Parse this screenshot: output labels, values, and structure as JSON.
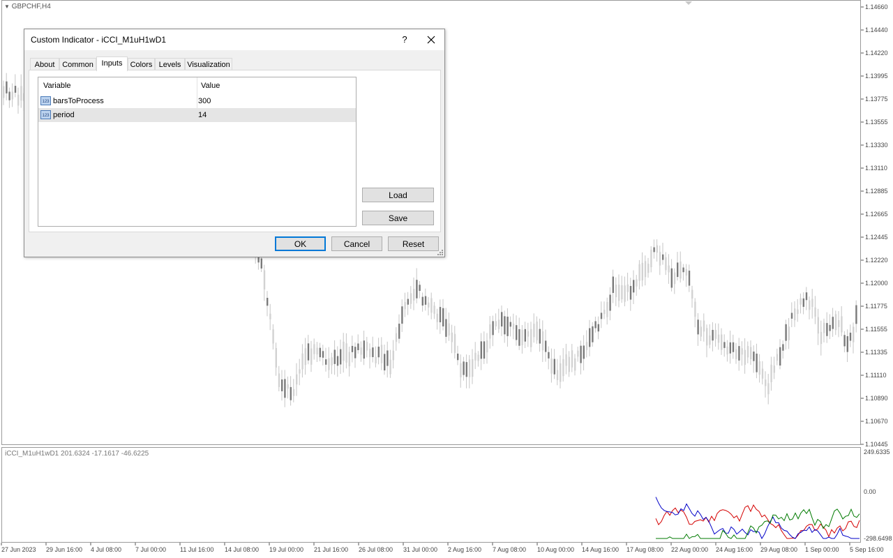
{
  "symbol_label": "GBPCHF,H4",
  "indicator_label": "iCCI_M1uH1wD1 201.6324 -17.1617 -46.6225",
  "price_axis": [
    "1.14660",
    "1.14440",
    "1.14220",
    "1.13995",
    "1.13775",
    "1.13555",
    "1.13330",
    "1.13110",
    "1.12885",
    "1.12665",
    "1.12445",
    "1.12220",
    "1.12000",
    "1.11775",
    "1.11555",
    "1.11335",
    "1.11110",
    "1.10890",
    "1.10670",
    "1.10445"
  ],
  "indicator_axis": [
    "249.6335",
    "0.00",
    "-298.6498"
  ],
  "time_axis": [
    "27 Jun 2023",
    "29 Jun 16:00",
    "4 Jul 08:00",
    "7 Jul 00:00",
    "11 Jul 16:00",
    "14 Jul 08:00",
    "19 Jul 00:00",
    "21 Jul 16:00",
    "26 Jul 08:00",
    "31 Jul 00:00",
    "2 Aug 16:00",
    "7 Aug 08:00",
    "10 Aug 00:00",
    "14 Aug 16:00",
    "17 Aug 08:00",
    "22 Aug 00:00",
    "24 Aug 16:00",
    "29 Aug 08:00",
    "1 Sep 00:00",
    "5 Sep 16:00"
  ],
  "colors": {
    "candle": "#7a7a7a",
    "wick": "#bdbdbd",
    "cci_red": "#d40000",
    "cci_blue": "#0000c8",
    "cci_green": "#007a00",
    "accent": "#0078d7"
  },
  "dialog": {
    "title": "Custom Indicator - iCCI_M1uH1wD1",
    "help": "?",
    "tabs": [
      "About",
      "Common",
      "Inputs",
      "Colors",
      "Levels",
      "Visualization"
    ],
    "active_tab": "Inputs",
    "grid": {
      "headers": [
        "Variable",
        "Value"
      ],
      "rows": [
        {
          "name": "barsToProcess",
          "value": "300",
          "icon": "integer-icon"
        },
        {
          "name": "period",
          "value": "14",
          "icon": "integer-icon"
        }
      ]
    },
    "buttons": {
      "load": "Load",
      "save": "Save",
      "ok": "OK",
      "cancel": "Cancel",
      "reset": "Reset"
    }
  }
}
